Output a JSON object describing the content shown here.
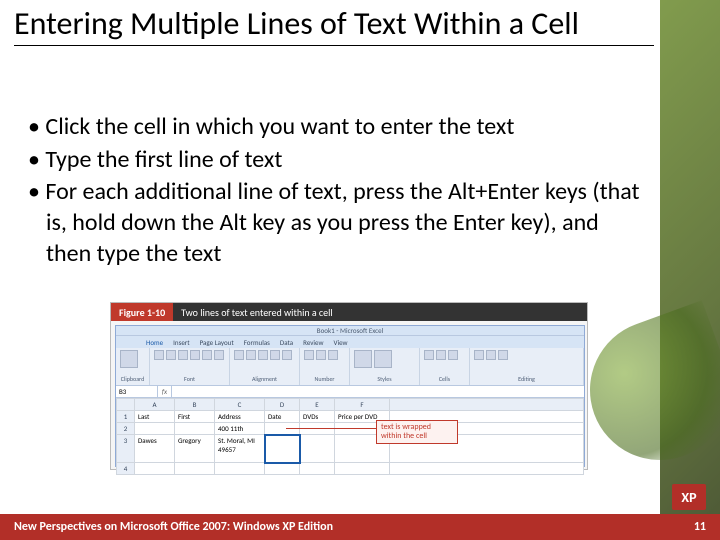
{
  "title": "Entering Multiple Lines of Text Within a Cell",
  "bullets": [
    "Click the cell in which you want to enter the text",
    "Type the first line of text",
    "For each additional line of text, press the Alt+Enter keys (that is, hold down the Alt key as you press the Enter key), and then type the text"
  ],
  "figure": {
    "label": "Figure 1-10",
    "caption": "Two lines of text entered within a cell",
    "excel_title": "Book1 - Microsoft Excel",
    "tabs": [
      "Home",
      "Insert",
      "Page Layout",
      "Formulas",
      "Data",
      "Review",
      "View"
    ],
    "ribbon_groups": [
      "Clipboard",
      "Font",
      "Alignment",
      "Number",
      "Styles",
      "Cells",
      "Editing"
    ],
    "namebox": "B3",
    "columns": [
      "A",
      "B",
      "C",
      "D",
      "E",
      "F"
    ],
    "rows": {
      "1": [
        "Last",
        "First",
        "Address",
        "Date",
        "DVDs",
        "Price per DVD"
      ],
      "2": [
        "",
        "",
        "400 11th",
        "",
        "",
        ""
      ],
      "3": [
        "Dawes",
        "Gregory",
        "St. Moral, MI 49657",
        "",
        "",
        ""
      ]
    },
    "callout": "text is wrapped within the cell"
  },
  "footer": {
    "left": "New Perspectives on Microsoft Office 2007: Windows XP Edition",
    "right": "11"
  },
  "badge": "XP"
}
